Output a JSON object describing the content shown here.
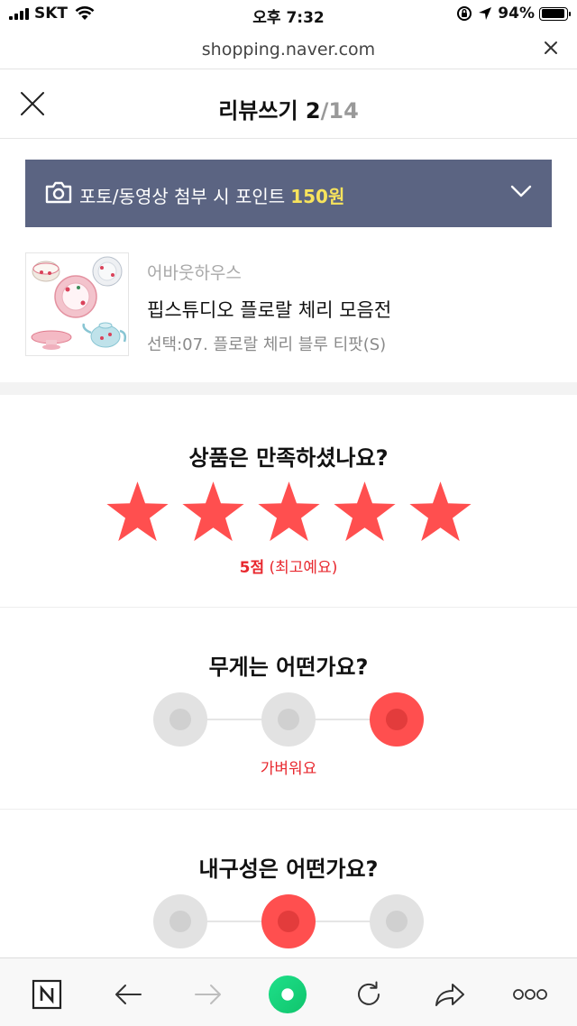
{
  "status_bar": {
    "carrier": "SKT",
    "time": "오후 7:32",
    "battery": "94%",
    "battery_level": 0.94
  },
  "browser": {
    "url": "shopping.naver.com"
  },
  "header": {
    "title": "리뷰쓰기",
    "current": "2",
    "total": "/14"
  },
  "banner": {
    "text": "포토/동영상 첨부 시 포인트",
    "points": "150원",
    "camera_icon": "camera-icon",
    "expand_icon": "chevron-down-icon"
  },
  "product": {
    "store": "어바웃하우스",
    "name": "핍스튜디오 플로랄 체리 모음전",
    "option": "선택:07. 플로랄 체리 블루 티팟(S)"
  },
  "rating": {
    "question": "상품은 만족하셨나요?",
    "score": 5,
    "max_score": 5,
    "score_label": "5점",
    "score_desc": "(최고예요)",
    "star_color": "#ff4f4f"
  },
  "weight": {
    "question": "무게는 어떤가요?",
    "selected_index": 2,
    "selected_label": "가벼워요"
  },
  "durability": {
    "question": "내구성은 어떤가요?",
    "selected_index": 1
  },
  "toolbar": {
    "items": [
      "naver-home-icon",
      "back-arrow-icon",
      "forward-arrow-icon",
      "green-dot-icon",
      "reload-icon",
      "share-icon",
      "more-icon"
    ]
  },
  "colors": {
    "accent_red": "#e8292f",
    "banner_bg": "#5b6482",
    "points_yellow": "#f7e35c",
    "green": "#1ed66a"
  }
}
